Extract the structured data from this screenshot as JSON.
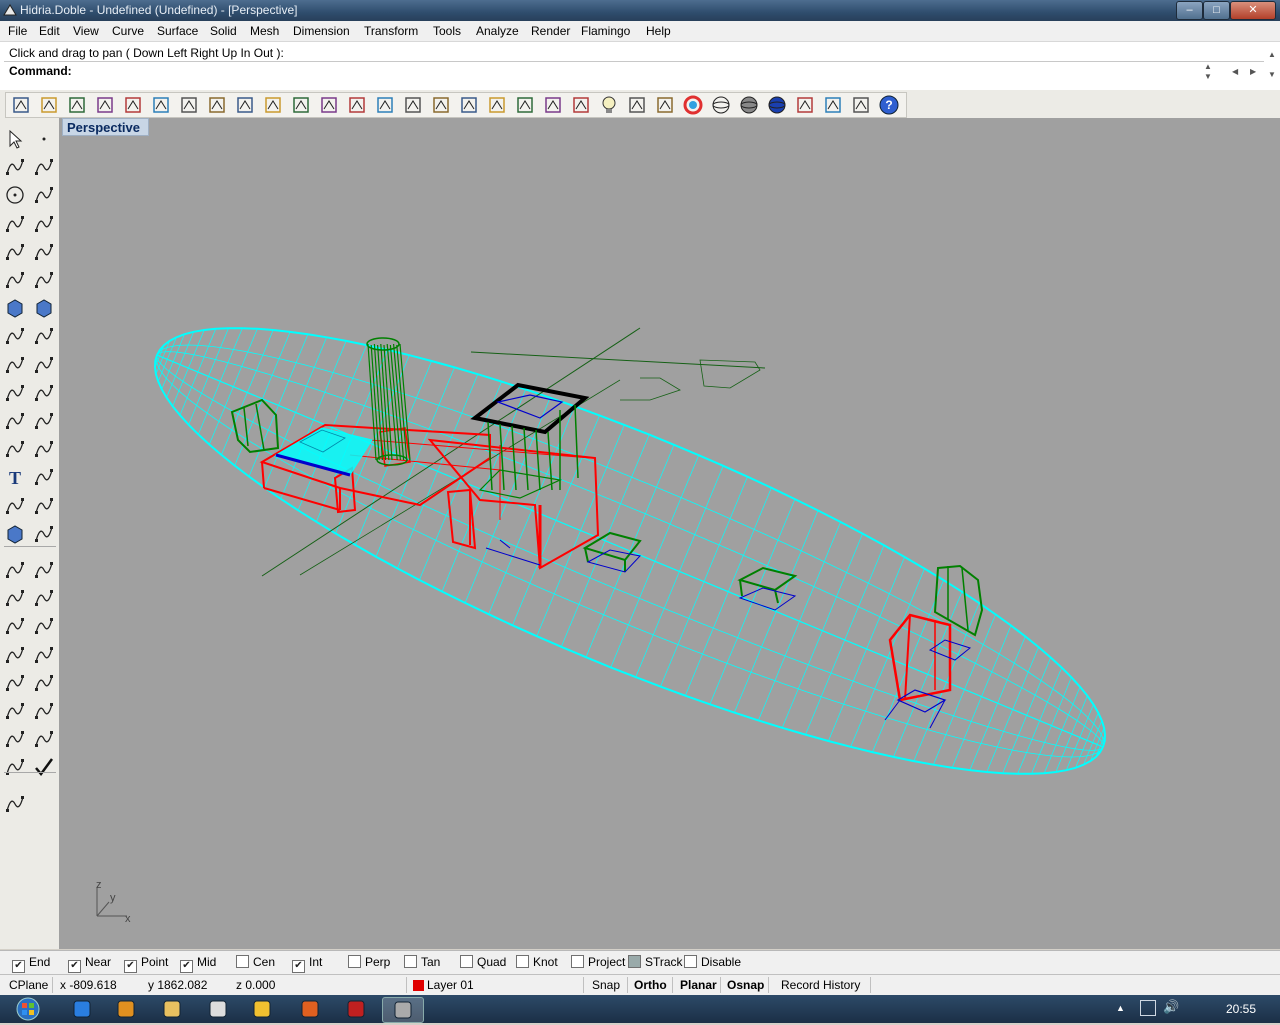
{
  "window": {
    "title": "Hidria.Doble - Undefined (Undefined) - [Perspective]",
    "buttons": [
      "minimize",
      "maximize",
      "close"
    ]
  },
  "menu": {
    "items": [
      "File",
      "Edit",
      "View",
      "Curve",
      "Surface",
      "Solid",
      "Mesh",
      "Dimension",
      "Transform",
      "Tools",
      "Analyze",
      "Render",
      "Flamingo",
      "Help"
    ]
  },
  "command": {
    "prompt_line": "Click and drag to pan ( Down  Left  Right  Up  In  Out ):",
    "label": "Command:",
    "value": ""
  },
  "toolbar": {
    "icons": [
      "new-file-icon",
      "open-folder-icon",
      "save-icon",
      "print-icon",
      "import-icon",
      "cut-icon",
      "copy-icon",
      "paste-icon",
      "undo-icon",
      "pan-hand-icon",
      "rotate-view-icon",
      "zoom-dynamic-icon",
      "zoom-window-icon",
      "zoom-extents-icon",
      "zoom-selected-icon",
      "undo-view-icon",
      "four-viewports-icon",
      "car-icon",
      "grid-icon",
      "cplane-icon",
      "points-icon",
      "light-bulb-icon",
      "lock-icon",
      "layer-icon",
      "color-wheel-icon",
      "wireframe-sphere-icon",
      "shaded-sphere-icon",
      "rendered-sphere-icon",
      "flag-icon",
      "gear-icon",
      "options-icon",
      "help-icon"
    ]
  },
  "left_toolbar": {
    "icons": [
      "select-arrow-icon",
      "point-icon",
      "polyline-icon",
      "curve-icon",
      "circle-icon",
      "ellipse-icon",
      "arc-icon",
      "rectangle-icon",
      "polygon-icon",
      "fillet-curve-icon",
      "surface-corner-icon",
      "revolve-icon",
      "box-solid-icon",
      "sphere-solid-icon",
      "cylinder-icon",
      "plane-surface-icon",
      "boolean-icon",
      "explode-icon",
      "mesh-icon",
      "split-icon",
      "boolean-union-icon",
      "join-icon",
      "bend-icon",
      "offset-icon",
      "text-icon",
      "extend-icon",
      "array-icon",
      "edit-points-icon",
      "cube-render-icon",
      "dimension-icon",
      "coordinates-icon",
      "dimension-linear-icon",
      "move-icon",
      "scale-icon",
      "rotate-icon",
      "analyze-icon",
      "mirror-icon",
      "layout-icon",
      "transform-icon",
      "zebra-icon",
      "copy-object-icon",
      "curvature-icon",
      "section-icon",
      "draft-icon",
      "render-preview-icon",
      "check-icon",
      "histogram-icon"
    ]
  },
  "viewport": {
    "tab_label": "Perspective",
    "axes": {
      "x": "x",
      "y": "y",
      "z": "z"
    },
    "colors": {
      "background": "#a0a0a0",
      "hull": "#00ffff",
      "red_objects": "#ff0000",
      "green_objects": "#008000",
      "blue_objects": "#0000cc",
      "black_objects": "#000000"
    }
  },
  "osnap": {
    "items": [
      {
        "label": "End",
        "checked": true
      },
      {
        "label": "Near",
        "checked": true
      },
      {
        "label": "Point",
        "checked": true
      },
      {
        "label": "Mid",
        "checked": true
      },
      {
        "label": "Cen",
        "checked": false
      },
      {
        "label": "Int",
        "checked": true
      },
      {
        "label": "Perp",
        "checked": false
      },
      {
        "label": "Tan",
        "checked": false
      },
      {
        "label": "Quad",
        "checked": false
      },
      {
        "label": "Knot",
        "checked": false
      },
      {
        "label": "Project",
        "checked": false
      },
      {
        "label": "STrack",
        "checked": false
      },
      {
        "label": "Disable",
        "checked": false
      }
    ]
  },
  "status": {
    "cplane": "CPlane",
    "x": "x -809.618",
    "y": "y 1862.082",
    "z": "z 0.000",
    "layer": "Layer 01",
    "layer_color": "#e00000",
    "snap": "Snap",
    "ortho": "Ortho",
    "planar": "Planar",
    "osnap": "Osnap",
    "record_history": "Record History"
  },
  "taskbar": {
    "icons": [
      "windows-start-icon",
      "internet-explorer-icon",
      "media-player-icon",
      "file-explorer-icon",
      "document-icon",
      "messenger-icon",
      "firefox-icon",
      "filezilla-icon",
      "rhino-icon",
      "rhino-active-icon"
    ],
    "clock": "20:55"
  }
}
